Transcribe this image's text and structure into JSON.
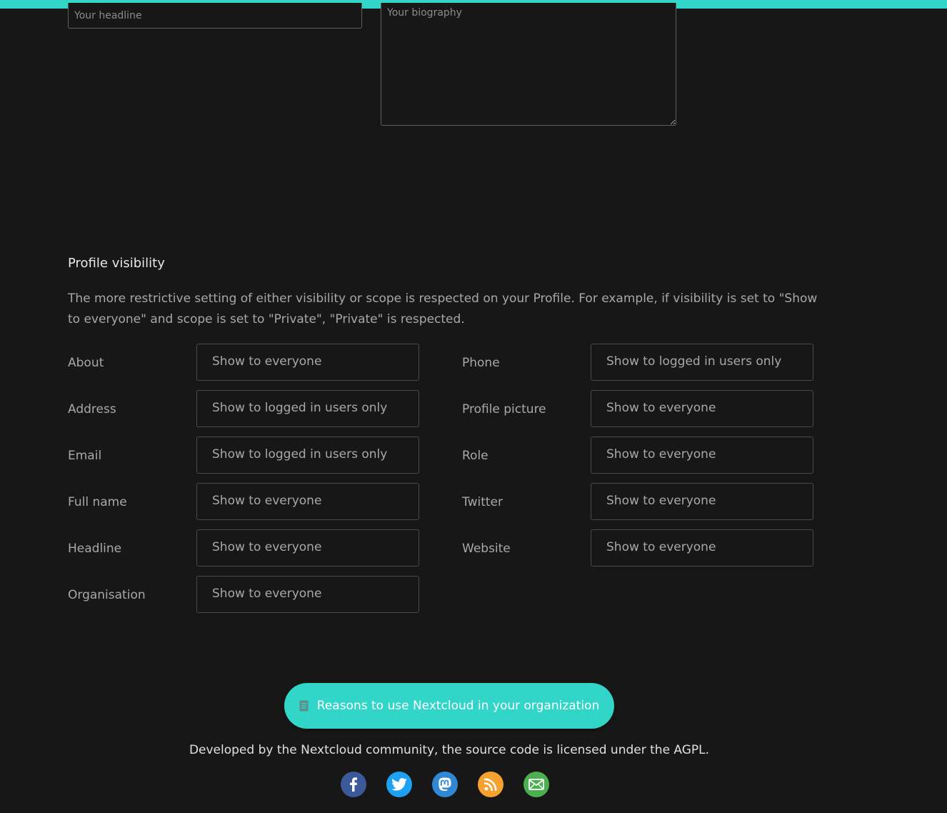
{
  "colors": {
    "accent": "#31d6c8",
    "background": "#171717",
    "facebook": "#3b5998",
    "twitter": "#1da1f2",
    "mastodon": "#3088d4",
    "rss": "#f7a230",
    "email": "#4caf50"
  },
  "profile_fields": {
    "headline_placeholder": "Your headline",
    "biography_placeholder": "Your biography"
  },
  "visibility": {
    "title": "Profile visibility",
    "description": "The more restrictive setting of either visibility or scope is respected on your Profile. For example, if visibility is set to \"Show to everyone\" and scope is set to \"Private\", \"Private\" is respected.",
    "left": [
      {
        "label": "About",
        "value": "Show to everyone"
      },
      {
        "label": "Address",
        "value": "Show to logged in users only"
      },
      {
        "label": "Email",
        "value": "Show to logged in users only"
      },
      {
        "label": "Full name",
        "value": "Show to everyone"
      },
      {
        "label": "Headline",
        "value": "Show to everyone"
      },
      {
        "label": "Organisation",
        "value": "Show to everyone"
      }
    ],
    "right": [
      {
        "label": "Phone",
        "value": "Show to logged in users only"
      },
      {
        "label": "Profile picture",
        "value": "Show to everyone"
      },
      {
        "label": "Role",
        "value": "Show to everyone"
      },
      {
        "label": "Twitter",
        "value": "Show to everyone"
      },
      {
        "label": "Website",
        "value": "Show to everyone"
      }
    ]
  },
  "footer": {
    "cta_label": "Reasons to use Nextcloud in your organization",
    "cta_icon": "document-icon",
    "credit": "Developed by the Nextcloud community, the source code is licensed under the AGPL.",
    "social": [
      "facebook-icon",
      "twitter-icon",
      "mastodon-icon",
      "rss-icon",
      "email-icon"
    ]
  }
}
